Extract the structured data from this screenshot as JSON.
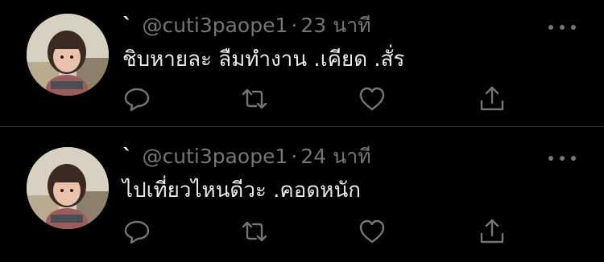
{
  "tweets": [
    {
      "display_name": "`",
      "handle": "@cuti3paope1",
      "separator": "·",
      "time": "23 นาที",
      "text": "ชิบหายละ ลืมทำงาน .เคียด .สั่ร"
    },
    {
      "display_name": "`",
      "handle": "@cuti3paope1",
      "separator": "·",
      "time": "24 นาที",
      "text": "ไปเที่ยวไหนดีวะ .คอดหนัก"
    }
  ],
  "icons": {
    "reply": "reply-icon",
    "retweet": "retweet-icon",
    "like": "heart-icon",
    "share": "share-icon",
    "more": "more-icon"
  },
  "colors": {
    "background": "#000000",
    "text": "#e7e9ea",
    "muted": "#71767b",
    "divider": "#2f3336"
  }
}
